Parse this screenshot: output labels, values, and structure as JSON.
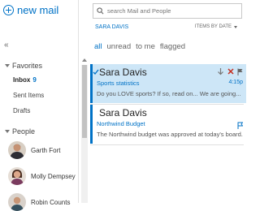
{
  "app": {
    "new_mail_label": "new mail"
  },
  "search": {
    "placeholder": "search Mail and People"
  },
  "context": {
    "user": "SARA DAVIS",
    "sort_label": "ITEMS BY DATE"
  },
  "filters": [
    {
      "label": "all",
      "active": true
    },
    {
      "label": "unread",
      "active": false
    },
    {
      "label": "to me",
      "active": false
    },
    {
      "label": "flagged",
      "active": false
    }
  ],
  "sidebar": {
    "collapse_glyph": "«",
    "favorites_header": "Favorites",
    "favorites": [
      {
        "label": "Inbox",
        "count": "9"
      },
      {
        "label": "Sent Items"
      },
      {
        "label": "Drafts"
      }
    ],
    "people_header": "People",
    "people": [
      {
        "name": "Garth Fort"
      },
      {
        "name": "Molly Dempsey"
      },
      {
        "name": "Robin Counts"
      }
    ]
  },
  "messages": [
    {
      "sender": "Sara Davis",
      "subject": "Sports statistics",
      "preview": "Do you LOVE sports?  If so, read on...  We are going...",
      "time": "4:15p",
      "selected": true,
      "icons": [
        "checkmark-icon",
        "move-down-icon",
        "delete-icon",
        "flag-icon"
      ]
    },
    {
      "sender": "Sara Davis",
      "subject": "Northwind Budget",
      "preview": "The Northwind budget was approved at today's board...",
      "time": "4:15p",
      "selected": false,
      "icons": [
        "flag-icon"
      ]
    }
  ],
  "colors": {
    "accent": "#0072c6",
    "selected_bg": "#cde6f7",
    "delete": "#c42b1c"
  }
}
